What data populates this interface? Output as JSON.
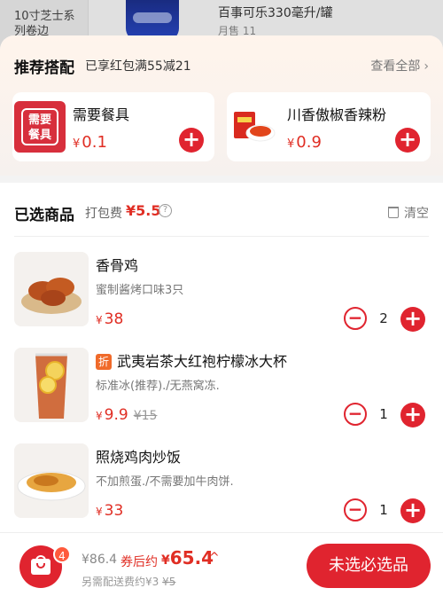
{
  "background": {
    "left_category": "10寸芝士系列卷边",
    "item_title": "百事可乐330毫升/罐",
    "item_sales": "月售 11"
  },
  "recommend": {
    "title": "推荐搭配",
    "promo": "已享红包满55减21",
    "view_all": "查看全部",
    "cards": [
      {
        "name": "需要餐具",
        "thumb_text": "需要餐具",
        "currency": "¥",
        "price": "0.1"
      },
      {
        "name": "川香傲椒香辣粉",
        "currency": "¥",
        "price": "0.9"
      }
    ]
  },
  "cart": {
    "title": "已选商品",
    "pack_fee_label": "打包费",
    "pack_fee": "¥5.5",
    "clear_label": "清空",
    "items": [
      {
        "name": "香骨鸡",
        "desc": "蜜制酱烤口味3只",
        "currency": "¥",
        "price": "38",
        "qty": "2"
      },
      {
        "name": "武夷岩茶大红袍柠檬冰大杯",
        "tag": "折",
        "desc": "标准冰(推荐)./无燕窝冻.",
        "currency": "¥",
        "price": "9.9",
        "orig_price": "¥15",
        "qty": "1"
      },
      {
        "name": "照烧鸡肉炒饭",
        "desc": "不加煎蛋./不需要加牛肉饼.",
        "currency": "¥",
        "price": "33",
        "qty": "1"
      }
    ]
  },
  "bottom": {
    "badge_count": "4",
    "total_orig": "¥86.4",
    "coupon_label": "券后约",
    "currency": "¥",
    "total_final": "65.4",
    "delivery_label": "另需配送费约¥3",
    "delivery_orig": "¥5",
    "checkout_label": "未选必选品"
  },
  "colors": {
    "accent": "#e0242f",
    "price": "#e02e24"
  }
}
